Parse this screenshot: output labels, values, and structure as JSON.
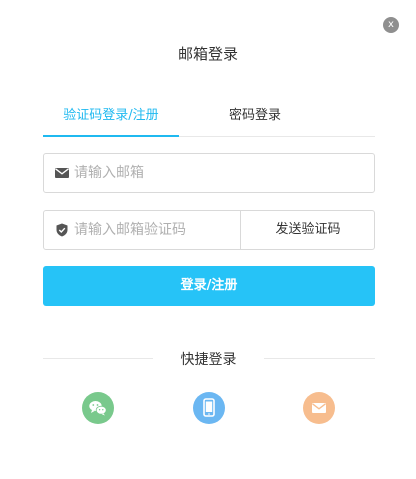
{
  "dialog": {
    "close_label": "x",
    "title": "邮箱登录"
  },
  "tabs": [
    {
      "label": "验证码登录/注册",
      "active": true
    },
    {
      "label": "密码登录",
      "active": false
    }
  ],
  "email_field": {
    "placeholder": "请输入邮箱",
    "value": "",
    "icon": "envelope-icon"
  },
  "code_field": {
    "placeholder": "请输入邮箱验证码",
    "value": "",
    "icon": "shield-check-icon",
    "send_label": "发送验证码"
  },
  "submit": {
    "label": "登录/注册"
  },
  "quick_login": {
    "title": "快捷登录",
    "options": [
      {
        "icon": "wechat-icon",
        "color": "#79c98c"
      },
      {
        "icon": "phone-icon",
        "color": "#6bb7f2"
      },
      {
        "icon": "email-icon",
        "color": "#f7bd8e"
      }
    ]
  },
  "colors": {
    "accent": "#1fb9f0",
    "button": "#26c3f7"
  }
}
